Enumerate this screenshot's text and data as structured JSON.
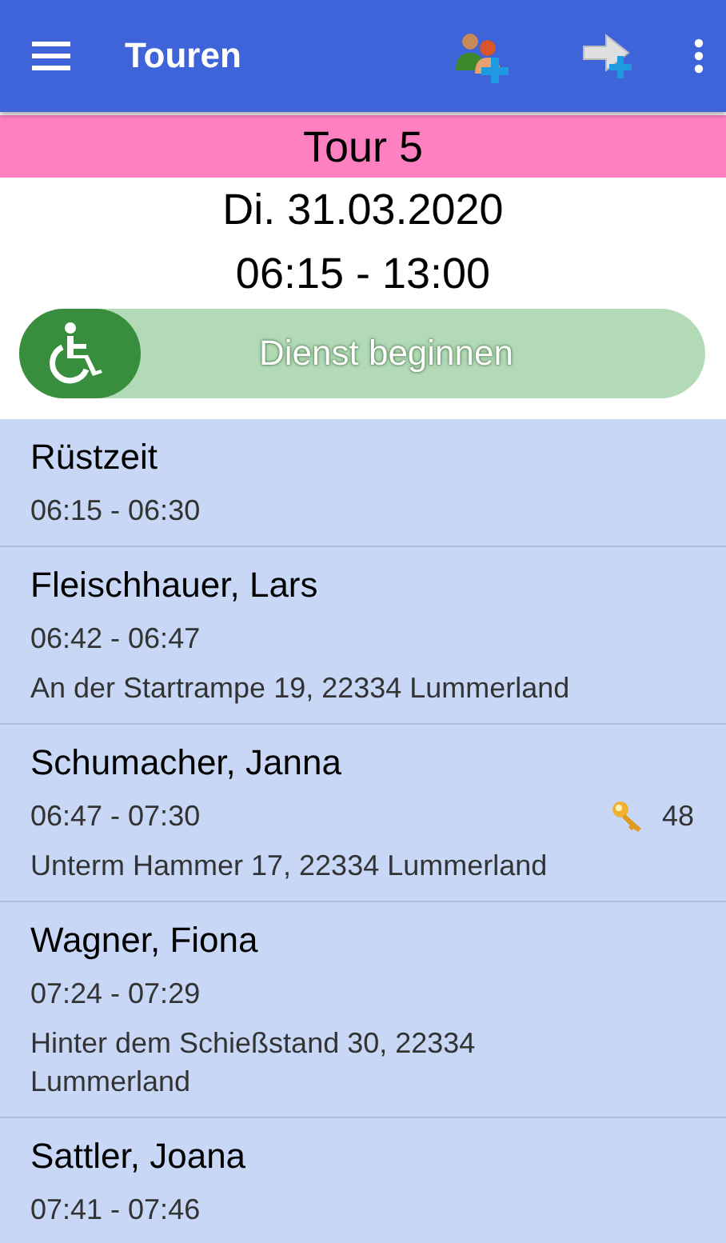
{
  "app_bar": {
    "title": "Touren"
  },
  "tour": {
    "name": "Tour 5",
    "date": "Di. 31.03.2020",
    "time": "06:15 - 13:00"
  },
  "swipe_button": {
    "label": "Dienst beginnen",
    "level": 0
  },
  "stops": [
    {
      "name": "Rüstzeit",
      "time": "06:15 - 06:30"
    },
    {
      "name": "Fleischhauer, Lars",
      "time": "06:42 - 06:47",
      "address": "An der Startrampe 19, 22334 Lummerland"
    },
    {
      "name": "Schumacher, Janna",
      "time": "06:47 - 07:30",
      "address": "Unterm Hammer 17, 22334 Lummerland",
      "key": "48"
    },
    {
      "name": "Wagner, Fiona",
      "time": "07:24 - 07:29",
      "address": "Hinter dem Schießstand 30, 22334 Lummerland"
    },
    {
      "name": "Sattler, Joana",
      "time": "07:41 - 07:46"
    }
  ]
}
